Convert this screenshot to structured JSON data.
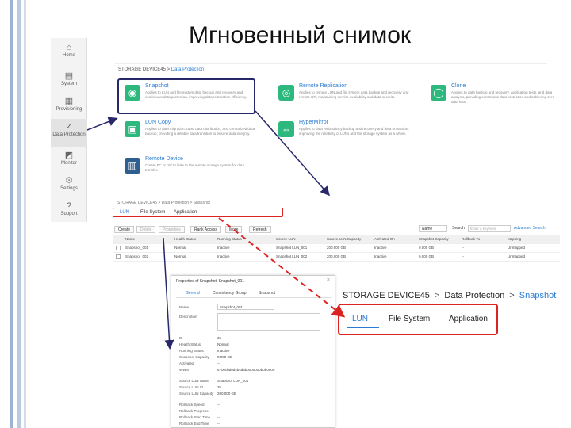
{
  "slide": {
    "title": "Мгновенный снимок"
  },
  "sidebar": {
    "items": [
      {
        "label": "Home",
        "icon": "home-icon",
        "glyph": "⌂"
      },
      {
        "label": "System",
        "icon": "system-icon",
        "glyph": "▤"
      },
      {
        "label": "Provisioning",
        "icon": "provisioning-icon",
        "glyph": "▦"
      },
      {
        "label": "Data Protection",
        "icon": "data-protection-icon",
        "glyph": "✓"
      },
      {
        "label": "Monitor",
        "icon": "monitor-icon",
        "glyph": "◩"
      },
      {
        "label": "Settings",
        "icon": "gear-icon",
        "glyph": "⚙"
      },
      {
        "label": "Support",
        "icon": "help-icon",
        "glyph": "?"
      }
    ]
  },
  "panel1": {
    "breadcrumb_device": "STORAGE DEVICE45",
    "breadcrumb_sep": ">",
    "breadcrumb_section": "Data Protection",
    "cards": [
      {
        "title": "Snapshot",
        "desc": "Applies to LUN and file system data backup and recovery and continuous data protection, improving data restoration efficiency.",
        "glyph": "◉"
      },
      {
        "title": "Remote Replication",
        "desc": "Applies to remote LUN and file system data backup and recovery and remote DR, maintaining service availability and data security.",
        "glyph": "◎"
      },
      {
        "title": "Clone",
        "desc": "Applies to data backup and recovery, application tests, and data analysis, providing continuous data protection and achieving zero data loss.",
        "glyph": "◯"
      },
      {
        "title": "LUN Copy",
        "desc": "Applies to data migration, rapid data distribution, and centralized data backup, providing a reliable data transition to ensure data integrity.",
        "glyph": "▣"
      },
      {
        "title": "HyperMirror",
        "desc": "Applies to data redundancy backup and recovery and data protection, improving the reliability of LUNs and the storage system as a whole.",
        "glyph": "⇔"
      },
      {
        "title": "Remote Device",
        "desc": "Create FC or iSCSI links to the remote storage system for data transfer.",
        "glyph": "▥"
      }
    ]
  },
  "panel2": {
    "breadcrumb": "STORAGE DEVICE45 > Data Protection > Snapshot",
    "tabs": [
      "LUN",
      "File System",
      "Application"
    ],
    "toolbar": [
      "Create",
      "Delete",
      "Properties",
      "Rank Access",
      "More",
      "Refresh"
    ],
    "filter_select": "Name",
    "search_label": "Search",
    "search_placeholder": "Enter a keyword",
    "advanced_search": "Advanced Search",
    "columns": [
      "Name",
      "Health Status",
      "Running Status",
      "Source LUN",
      "Source LUN Capacity",
      "Activated On",
      "Snapshot Capacity",
      "Rollback To",
      "Mapping"
    ],
    "rows": [
      [
        "Snapshot_001",
        "Normal",
        "Inactive",
        "Snapshot LUN_001",
        "200.000 GB",
        "Inactive",
        "0.000 GB",
        "--",
        "Unmapped"
      ],
      [
        "Snapshot_002",
        "Normal",
        "Inactive",
        "Snapshot LUN_002",
        "200.000 GB",
        "Inactive",
        "0.000 GB",
        "--",
        "Unmapped"
      ]
    ]
  },
  "dialog": {
    "title": "Properties of Snapshot: Snapshot_001",
    "close_glyph": "×",
    "tabs": [
      "General",
      "Consistency Group",
      "Snapshot"
    ],
    "name_label": "Name",
    "name_value": "Snapshot_001",
    "desc_label": "Description",
    "fields": [
      {
        "label": "ID",
        "value": "35"
      },
      {
        "label": "Health Status",
        "value": "Normal"
      },
      {
        "label": "Running Status",
        "value": "Inactive"
      },
      {
        "label": "Snapshot Capacity",
        "value": "0.000 GB"
      },
      {
        "label": "Activated",
        "value": "--"
      },
      {
        "label": "WWN",
        "value": "6700cbd0d4b4d8b0000000b0b0000"
      },
      {
        "label": "Source LUN Name",
        "value": "Snapshot LUN_001"
      },
      {
        "label": "Source LUN ID",
        "value": "35"
      },
      {
        "label": "Source LUN Capacity",
        "value": "200.000 GB"
      },
      {
        "label": "Rollback Speed",
        "value": "--"
      },
      {
        "label": "Rollback Progress",
        "value": "--"
      },
      {
        "label": "Rollback Start Time",
        "value": "--"
      },
      {
        "label": "Rollback End Time",
        "value": "--"
      }
    ]
  },
  "zoom": {
    "device": "STORAGE DEVICE45",
    "sep": ">",
    "section": "Data Protection",
    "page": "Snapshot",
    "tabs": [
      "LUN",
      "File System",
      "Application"
    ]
  },
  "colors": {
    "accent": "#2a7bd1",
    "highlight_red": "#dd2222",
    "highlight_navy": "#27276a",
    "card_green": "#2db87d"
  }
}
